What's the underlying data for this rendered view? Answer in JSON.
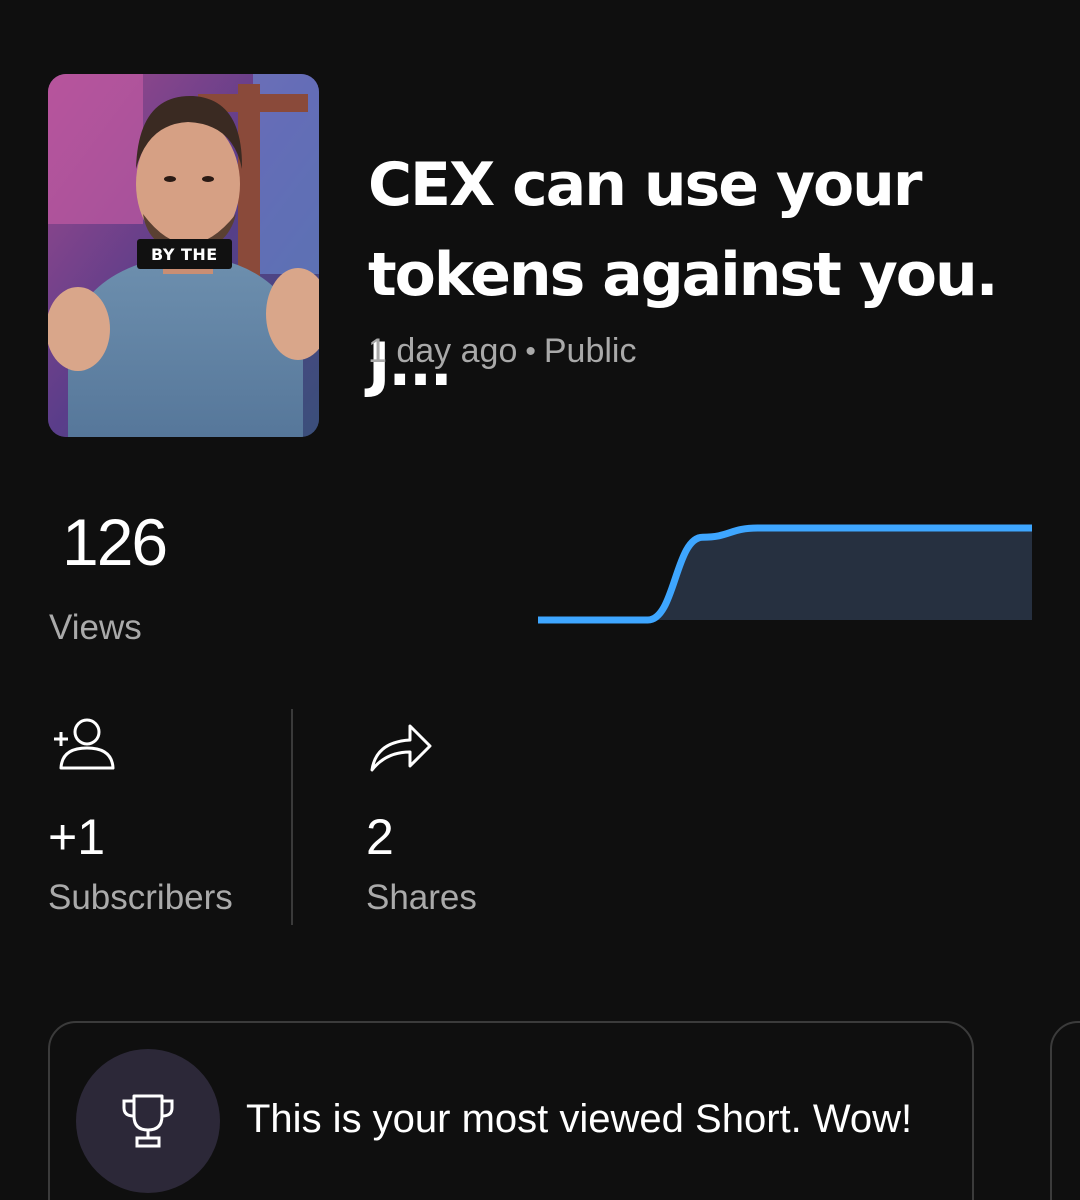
{
  "video": {
    "title": "CEX can use your tokens against you. J...",
    "age": "1 day ago",
    "separator": "•",
    "visibility": "Public",
    "thumbnail_overlay": "BY THE"
  },
  "views": {
    "value": "126",
    "label": "Views",
    "line_color": "#3ea6ff",
    "fill_color": "#263040"
  },
  "stats": {
    "subscribers": {
      "value": "+1",
      "label": "Subscribers",
      "icon": "add-person-icon"
    },
    "shares": {
      "value": "2",
      "label": "Shares",
      "icon": "share-arrow-icon"
    }
  },
  "achievement": {
    "text": "This is your most viewed Short. Wow!",
    "icon": "trophy-icon"
  },
  "chart_data": {
    "type": "area",
    "series": [
      {
        "values": [
          0,
          0,
          0,
          0.9,
          1,
          1,
          1,
          1,
          1,
          1
        ]
      }
    ],
    "ylim": [
      0,
      1
    ]
  }
}
